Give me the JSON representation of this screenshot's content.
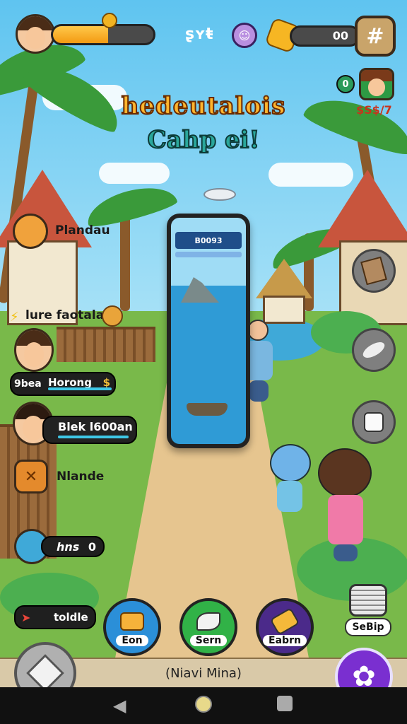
{
  "header": {
    "top_icon_label": "ʂʏŧ",
    "counter_value": "00"
  },
  "corner": {
    "coin_count": "0",
    "currency_text": "$S$/7"
  },
  "title": {
    "line1": "hedeutalois",
    "line2": "Cahp ei!"
  },
  "phone": {
    "header_text": "B0093"
  },
  "left_menu": [
    {
      "label": "Plandau"
    },
    {
      "label": "lure faotala"
    },
    {
      "label": "Nlande"
    }
  ],
  "players": [
    {
      "tag": "9bea",
      "name": "Horong",
      "badge": "$"
    },
    {
      "name": "Blek l600an"
    }
  ],
  "stats": {
    "lives_label": "hns",
    "lives_value": "0",
    "toolbar_label": "toldle"
  },
  "actions": [
    {
      "label": "Eon",
      "color": "#2b8fd8"
    },
    {
      "label": "Sern",
      "color": "#31b247"
    },
    {
      "label": "Eabrn",
      "color": "#4b2a8a"
    }
  ],
  "settings_label": "SeBip",
  "nav_strip_text": "(Niavi Mina)",
  "colors": {
    "bar_fill": "#f39a12",
    "accent_purple": "#7a2fd0",
    "title_orange": "#ffb52e",
    "title_teal": "#2aa79b"
  }
}
